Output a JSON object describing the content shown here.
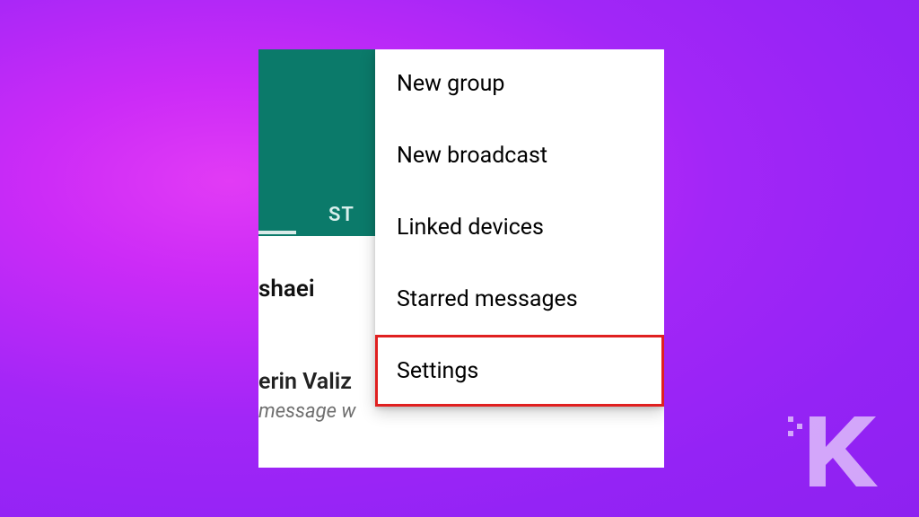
{
  "header": {
    "tab_partial": "ST"
  },
  "chats": {
    "row1_name_partial": "shaei",
    "row2_name_partial": "erin Vali",
    "row2_sub_partial": "message w"
  },
  "menu": {
    "items": [
      {
        "label": "New group"
      },
      {
        "label": "New broadcast"
      },
      {
        "label": "Linked devices"
      },
      {
        "label": "Starred messages"
      },
      {
        "label": "Settings"
      }
    ]
  }
}
